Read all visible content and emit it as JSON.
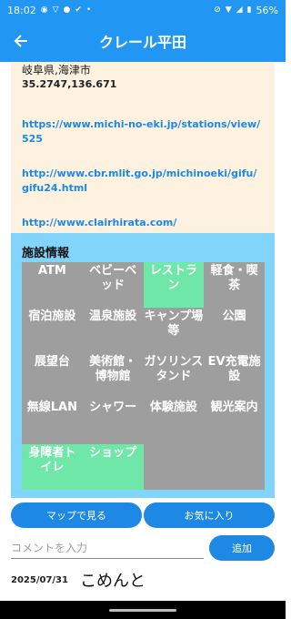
{
  "status_bar": {
    "time": "18:02",
    "battery": "56%"
  },
  "app_bar": {
    "title": "クレール平田"
  },
  "info": {
    "address": "岐阜県,海津市",
    "coords": "35.2747,136.671",
    "links": [
      "https://www.michi-no-eki.jp/stations/view/525",
      "http://www.cbr.mlit.go.jp/michinoeki/gifu/gifu24.html",
      "http://www.clairhirata.com/"
    ]
  },
  "facilities": {
    "title": "施設情報",
    "items": [
      {
        "label": "ATM",
        "active": false
      },
      {
        "label": "ベビーベッド",
        "active": false
      },
      {
        "label": "レストラン",
        "active": true
      },
      {
        "label": "軽食・喫茶",
        "active": false
      },
      {
        "label": "宿泊施設",
        "active": false
      },
      {
        "label": "温泉施設",
        "active": false
      },
      {
        "label": "キャンプ場等",
        "active": false
      },
      {
        "label": "公園",
        "active": false
      },
      {
        "label": "展望台",
        "active": false
      },
      {
        "label": "美術館・博物館",
        "active": false
      },
      {
        "label": "ガソリンスタンド",
        "active": false
      },
      {
        "label": "EV充電施設",
        "active": false
      },
      {
        "label": "無線LAN",
        "active": false
      },
      {
        "label": "シャワー",
        "active": false
      },
      {
        "label": "体験施設",
        "active": false
      },
      {
        "label": "観光案内",
        "active": false
      },
      {
        "label": "身障者トイレ",
        "active": true
      },
      {
        "label": "ショップ",
        "active": true
      }
    ]
  },
  "actions": {
    "map_label": "マップで見る",
    "favorite_label": "お気に入り"
  },
  "comment_form": {
    "placeholder": "コメントを入力",
    "add_label": "追加"
  },
  "comments": [
    {
      "date": "2025/07/31",
      "text": "こめんと"
    }
  ],
  "colors": {
    "primary": "#2196f3",
    "button": "#1e88e5",
    "facility_bg": "#81d4fa",
    "info_bg": "#fdf1df",
    "active_cell": "#6ee7a8",
    "inactive_cell": "#9e9e9e"
  }
}
